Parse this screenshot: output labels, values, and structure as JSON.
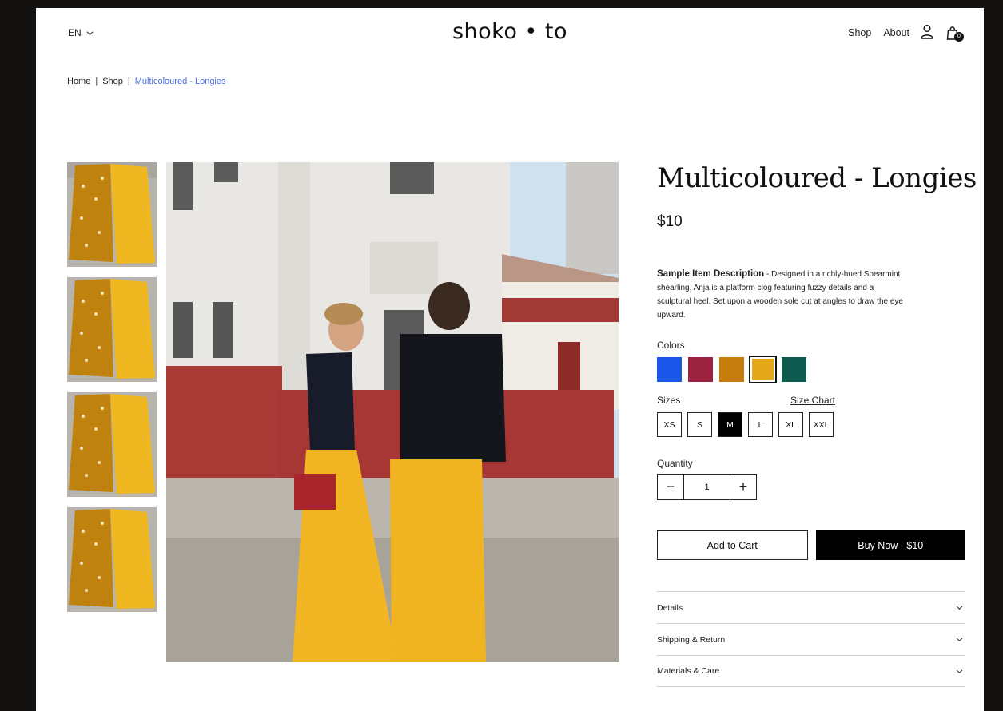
{
  "header": {
    "language": "EN",
    "logo": "shoko • to",
    "nav": [
      "Shop",
      "About"
    ],
    "cart_count": "0"
  },
  "breadcrumb": {
    "items": [
      "Home",
      "Shop"
    ],
    "current": "Multicoloured - Longies"
  },
  "product": {
    "title": "Multicoloured - Longies",
    "price": "$10",
    "description_title": "Sample Item Description",
    "description_body": " - Designed in a richly-hued Spearmint shearling, Anja is a platform clog featuring fuzzy details and a sculptural heel. Set upon a wooden sole cut at angles to draw the eye upward.",
    "colors_label": "Colors",
    "colors": [
      "#1a56e8",
      "#9c2340",
      "#c57c0c",
      "#e5a81a",
      "#0e5a4e"
    ],
    "selected_color_index": 3,
    "sizes_label": "Sizes",
    "size_chart_label": "Size Chart",
    "sizes": [
      "XS",
      "S",
      "M",
      "L",
      "XL",
      "XXL"
    ],
    "selected_size": "M",
    "quantity_label": "Quantity",
    "quantity_minus": "−",
    "quantity": "1",
    "quantity_plus": "+",
    "add_to_cart": "Add to Cart",
    "buy_now": "Buy Now - $10"
  },
  "accordion": [
    "Details",
    "Shipping & Return",
    "Materials & Care"
  ],
  "icons": {
    "language_dropdown": "chevron-down-icon",
    "account": "user-icon",
    "cart": "shopping-bag-icon",
    "accordion": "chevron-down-icon"
  }
}
